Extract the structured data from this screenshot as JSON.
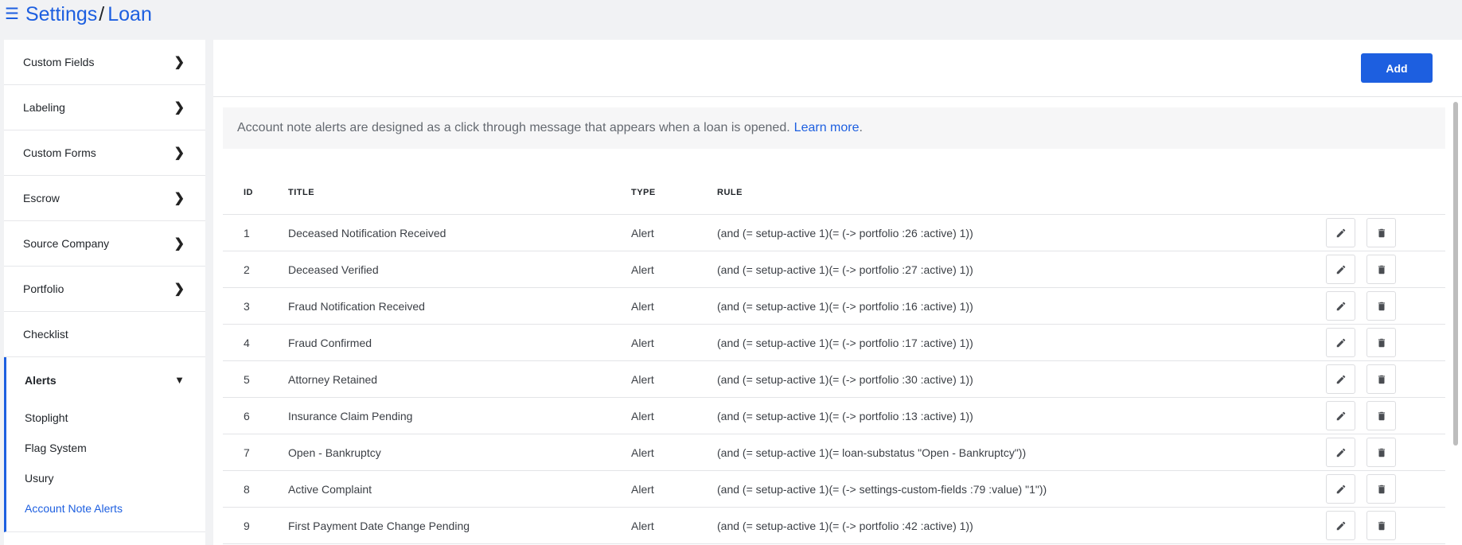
{
  "breadcrumb": {
    "root": "Settings",
    "separator": "/",
    "current": "Loan"
  },
  "sidebar": {
    "items": [
      {
        "label": "Custom Fields"
      },
      {
        "label": "Labeling"
      },
      {
        "label": "Custom Forms"
      },
      {
        "label": "Escrow"
      },
      {
        "label": "Source Company"
      },
      {
        "label": "Portfolio"
      },
      {
        "label": "Checklist"
      }
    ],
    "active": {
      "label": "Alerts",
      "subitems": [
        "Stoplight",
        "Flag System",
        "Usury",
        "Account Note Alerts"
      ]
    }
  },
  "toolbar": {
    "add_label": "Add"
  },
  "notice": {
    "text": "Account note alerts are designed as a click through message that appears when a loan is opened.",
    "link": "Learn more",
    "period": "."
  },
  "table": {
    "headers": {
      "id": "ID",
      "title": "TITLE",
      "type": "TYPE",
      "rule": "RULE"
    },
    "rows": [
      {
        "id": "1",
        "title": "Deceased Notification Received",
        "type": "Alert",
        "rule": "(and (= setup-active 1)(= (-> portfolio :26 :active) 1))"
      },
      {
        "id": "2",
        "title": "Deceased Verified",
        "type": "Alert",
        "rule": "(and (= setup-active 1)(= (-> portfolio :27 :active) 1))"
      },
      {
        "id": "3",
        "title": "Fraud Notification Received",
        "type": "Alert",
        "rule": "(and (= setup-active 1)(= (-> portfolio :16 :active) 1))"
      },
      {
        "id": "4",
        "title": "Fraud Confirmed",
        "type": "Alert",
        "rule": "(and (= setup-active 1)(= (-> portfolio :17 :active) 1))"
      },
      {
        "id": "5",
        "title": "Attorney Retained",
        "type": "Alert",
        "rule": "(and (= setup-active 1)(= (-> portfolio :30 :active) 1))"
      },
      {
        "id": "6",
        "title": "Insurance Claim Pending",
        "type": "Alert",
        "rule": "(and (= setup-active 1)(= (-> portfolio :13 :active) 1))"
      },
      {
        "id": "7",
        "title": "Open - Bankruptcy",
        "type": "Alert",
        "rule": "(and (= setup-active 1)(= loan-substatus \"Open - Bankruptcy\"))"
      },
      {
        "id": "8",
        "title": "Active Complaint",
        "type": "Alert",
        "rule": "(and (= setup-active 1)(= (-> settings-custom-fields :79 :value) \"1\"))"
      },
      {
        "id": "9",
        "title": "First Payment Date Change Pending",
        "type": "Alert",
        "rule": "(and (= setup-active 1)(= (-> portfolio :42 :active) 1))"
      }
    ]
  },
  "icons": {
    "menu": "hamburger-icon",
    "chevron": "chevron-right-icon",
    "expand": "chevron-down-icon",
    "edit": "pencil-icon",
    "delete": "trash-icon"
  },
  "colors": {
    "accent": "#1d5fe0"
  }
}
